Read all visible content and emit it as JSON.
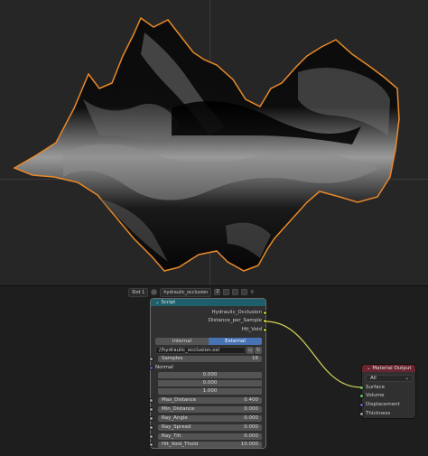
{
  "header": {
    "slot": "Slot 1",
    "material_name": "hydraulic_occlusion",
    "user_count": "2"
  },
  "script_node": {
    "title": "Script",
    "outputs": [
      "Hydraulic_Occlusion",
      "Distance_per_Sample",
      "Hit_Void"
    ],
    "mode_internal": "Internal",
    "mode_external": "External",
    "filepath": "//hydraulic_occlusion.osl",
    "samples_label": "Samples",
    "samples_value": "16",
    "normal_label": "Normal",
    "normal": [
      "0.000",
      "0.000",
      "1.000"
    ],
    "params": [
      {
        "label": "Max_Distance",
        "value": "0.400"
      },
      {
        "label": "Min_Distance",
        "value": "0.000"
      },
      {
        "label": "Ray_Angle",
        "value": "0.000"
      },
      {
        "label": "Ray_Spread",
        "value": "0.000"
      },
      {
        "label": "Ray_Tilt",
        "value": "0.000"
      },
      {
        "label": "Hit_Void_Thold",
        "value": "10.000"
      }
    ]
  },
  "output_node": {
    "title": "Material Output",
    "target": "All",
    "inputs": [
      "Surface",
      "Volume",
      "Displacement",
      "Thickness"
    ]
  },
  "colors": {
    "selection_outline": "#e8892a",
    "script_header": "#1d5f6a",
    "output_header": "#6a2530",
    "link": "#d4d45a"
  }
}
